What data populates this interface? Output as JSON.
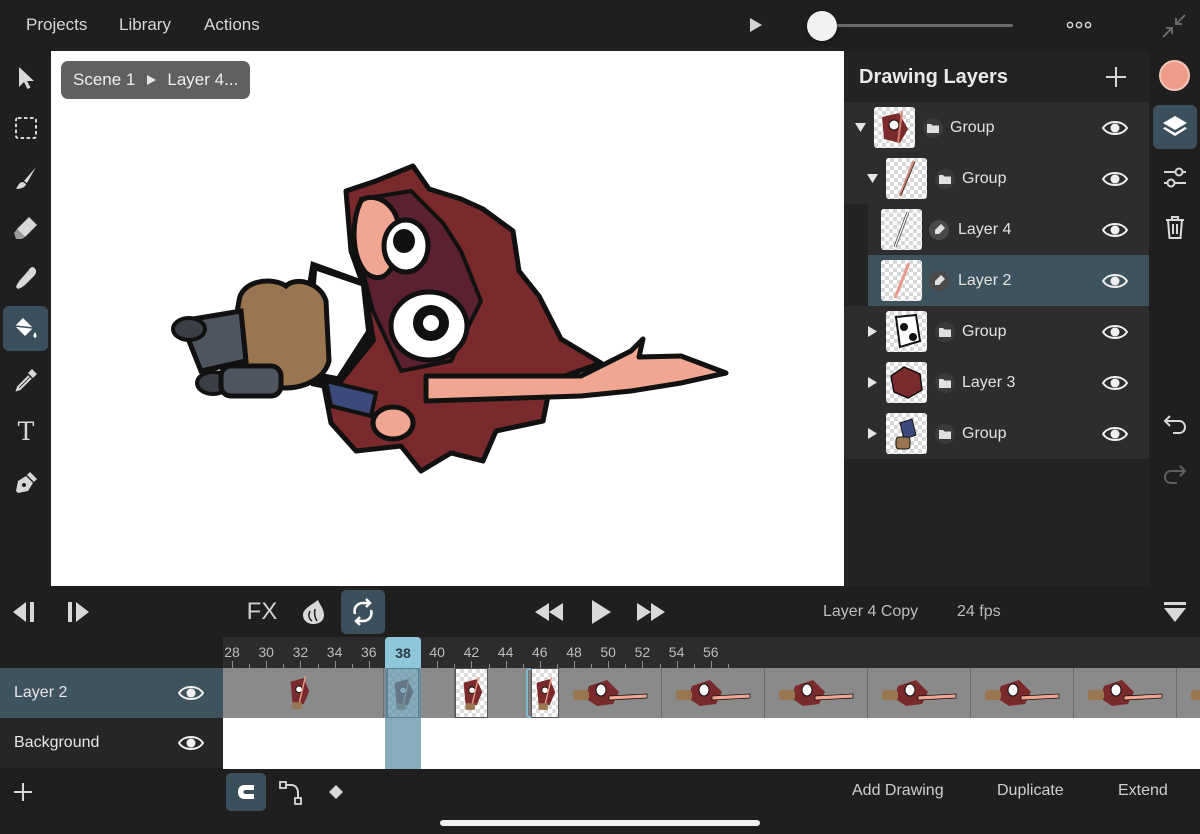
{
  "menu": {
    "projects": "Projects",
    "library": "Library",
    "actions": "Actions"
  },
  "scrubber": {
    "position": 0.02
  },
  "breadcrumb": {
    "scene": "Scene 1",
    "layer": "Layer 4..."
  },
  "layers_panel": {
    "title": "Drawing Layers",
    "rows": [
      {
        "name": "Group",
        "type": "folder",
        "expanded": true,
        "indent": 0,
        "selected": false
      },
      {
        "name": "Group",
        "type": "folder",
        "expanded": true,
        "indent": 1,
        "selected": false
      },
      {
        "name": "Layer 4",
        "type": "vector",
        "expanded": null,
        "indent": 2,
        "selected": false
      },
      {
        "name": "Layer 2",
        "type": "vector",
        "expanded": null,
        "indent": 2,
        "selected": true
      },
      {
        "name": "Group",
        "type": "folder",
        "expanded": false,
        "indent": 1,
        "selected": false
      },
      {
        "name": "Layer 3",
        "type": "folder",
        "expanded": false,
        "indent": 1,
        "selected": false
      },
      {
        "name": "Group",
        "type": "folder",
        "expanded": false,
        "indent": 1,
        "selected": false
      }
    ]
  },
  "colors": {
    "accent": "#3c4f5c",
    "playhead": "#8fc6da",
    "current_color": "#ee9c88"
  },
  "transport": {
    "fx": "FX",
    "layer_name": "Layer 4 Copy",
    "fps": "24 fps"
  },
  "timeline": {
    "frame_labels": [
      "28",
      "30",
      "32",
      "34",
      "36",
      "38",
      "40",
      "42",
      "44",
      "46",
      "48",
      "50",
      "52",
      "54",
      "56"
    ],
    "current_frame": "38",
    "tracks": [
      {
        "name": "Layer 2",
        "selected": true
      },
      {
        "name": "Background",
        "selected": false
      }
    ]
  },
  "bottom": {
    "add_drawing": "Add Drawing",
    "duplicate": "Duplicate",
    "extend": "Extend"
  }
}
